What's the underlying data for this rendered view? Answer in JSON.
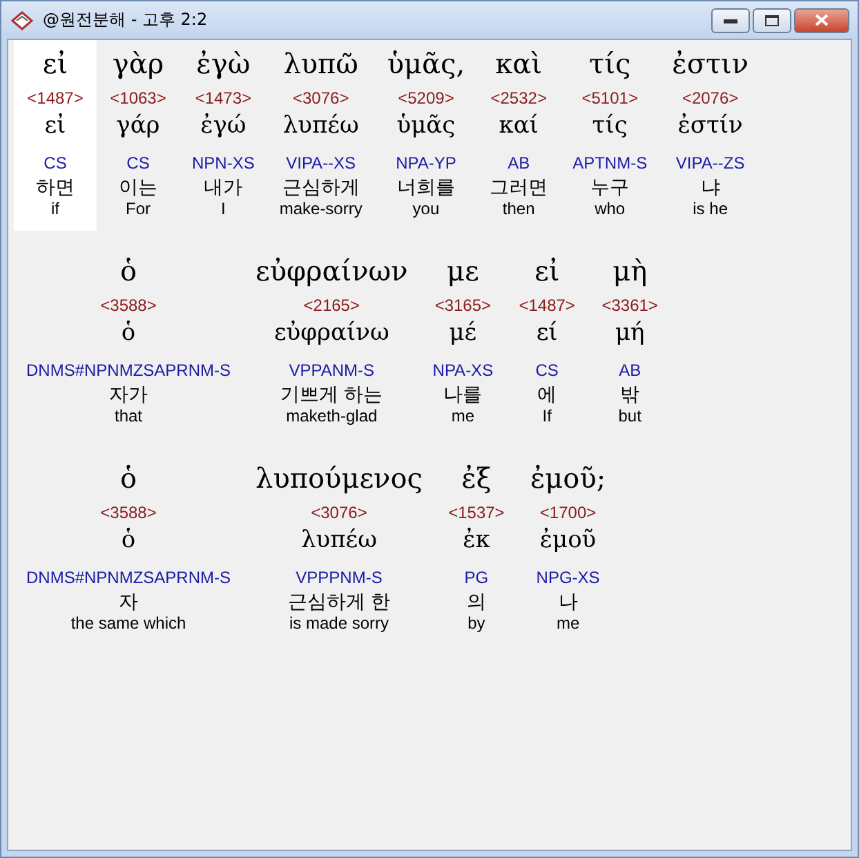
{
  "window": {
    "title": "@원전분해 - 고후 2:2"
  },
  "lines": [
    {
      "words": [
        {
          "greek": "εἰ",
          "strong": "<1487>",
          "lemma": "εἰ",
          "parsing": "CS",
          "korean": "하면",
          "english": "if",
          "selected": true
        },
        {
          "greek": "γὰρ",
          "strong": "<1063>",
          "lemma": "γάρ",
          "parsing": "CS",
          "korean": "이는",
          "english": "For",
          "selected": false
        },
        {
          "greek": "ἐγὼ",
          "strong": "<1473>",
          "lemma": "ἐγώ",
          "parsing": "NPN-XS",
          "korean": "내가",
          "english": "I",
          "selected": false
        },
        {
          "greek": "λυπῶ",
          "strong": "<3076>",
          "lemma": "λυπέω",
          "parsing": "VIPA--XS",
          "korean": "근심하게",
          "english": "make-sorry",
          "selected": false
        },
        {
          "greek": "ὑμᾶς,",
          "strong": "<5209>",
          "lemma": "ὑμᾶς",
          "parsing": "NPA-YP",
          "korean": "너희를",
          "english": "you",
          "selected": false
        },
        {
          "greek": "καὶ",
          "strong": "<2532>",
          "lemma": "καί",
          "parsing": "AB",
          "korean": "그러면",
          "english": "then",
          "selected": false
        },
        {
          "greek": "τίς",
          "strong": "<5101>",
          "lemma": "τίς",
          "parsing": "APTNM-S",
          "korean": "누구",
          "english": "who",
          "selected": false
        },
        {
          "greek": "ἐστιν",
          "strong": "<2076>",
          "lemma": "ἐστίν",
          "parsing": "VIPA--ZS",
          "korean": "냐",
          "english": "is he",
          "selected": false
        }
      ]
    },
    {
      "words": [
        {
          "greek": "ὁ",
          "strong": "<3588>",
          "lemma": "ὁ",
          "parsing": "DNMS#NPNMZSAPRNM-S",
          "korean": "자가",
          "english": "that",
          "selected": false
        },
        {
          "greek": "εὐφραίνων",
          "strong": "<2165>",
          "lemma": "εὐφραίνω",
          "parsing": "VPPANM-S",
          "korean": "기쁘게 하는",
          "english": "maketh-glad",
          "selected": false
        },
        {
          "greek": "με",
          "strong": "<3165>",
          "lemma": "μέ",
          "parsing": "NPA-XS",
          "korean": "나를",
          "english": "me",
          "selected": false
        },
        {
          "greek": "εἰ",
          "strong": "<1487>",
          "lemma": "εί",
          "parsing": "CS",
          "korean": "에",
          "english": "If",
          "selected": false
        },
        {
          "greek": "μὴ",
          "strong": "<3361>",
          "lemma": "μή",
          "parsing": "AB",
          "korean": "밖",
          "english": "but",
          "selected": false
        }
      ]
    },
    {
      "words": [
        {
          "greek": "ὁ",
          "strong": "<3588>",
          "lemma": "ὁ",
          "parsing": "DNMS#NPNMZSAPRNM-S",
          "korean": "자",
          "english": "the same which",
          "selected": false
        },
        {
          "greek": "λυπούμενος",
          "strong": "<3076>",
          "lemma": "λυπέω",
          "parsing": "VPPPNM-S",
          "korean": "근심하게 한",
          "english": "is made sorry",
          "selected": false
        },
        {
          "greek": "ἐξ",
          "strong": "<1537>",
          "lemma": "ἐκ",
          "parsing": "PG",
          "korean": "의",
          "english": "by",
          "selected": false
        },
        {
          "greek": "ἐμοῦ;",
          "strong": "<1700>",
          "lemma": "ἐμοῦ",
          "parsing": "NPG-XS",
          "korean": "나",
          "english": "me",
          "selected": false
        }
      ]
    }
  ]
}
